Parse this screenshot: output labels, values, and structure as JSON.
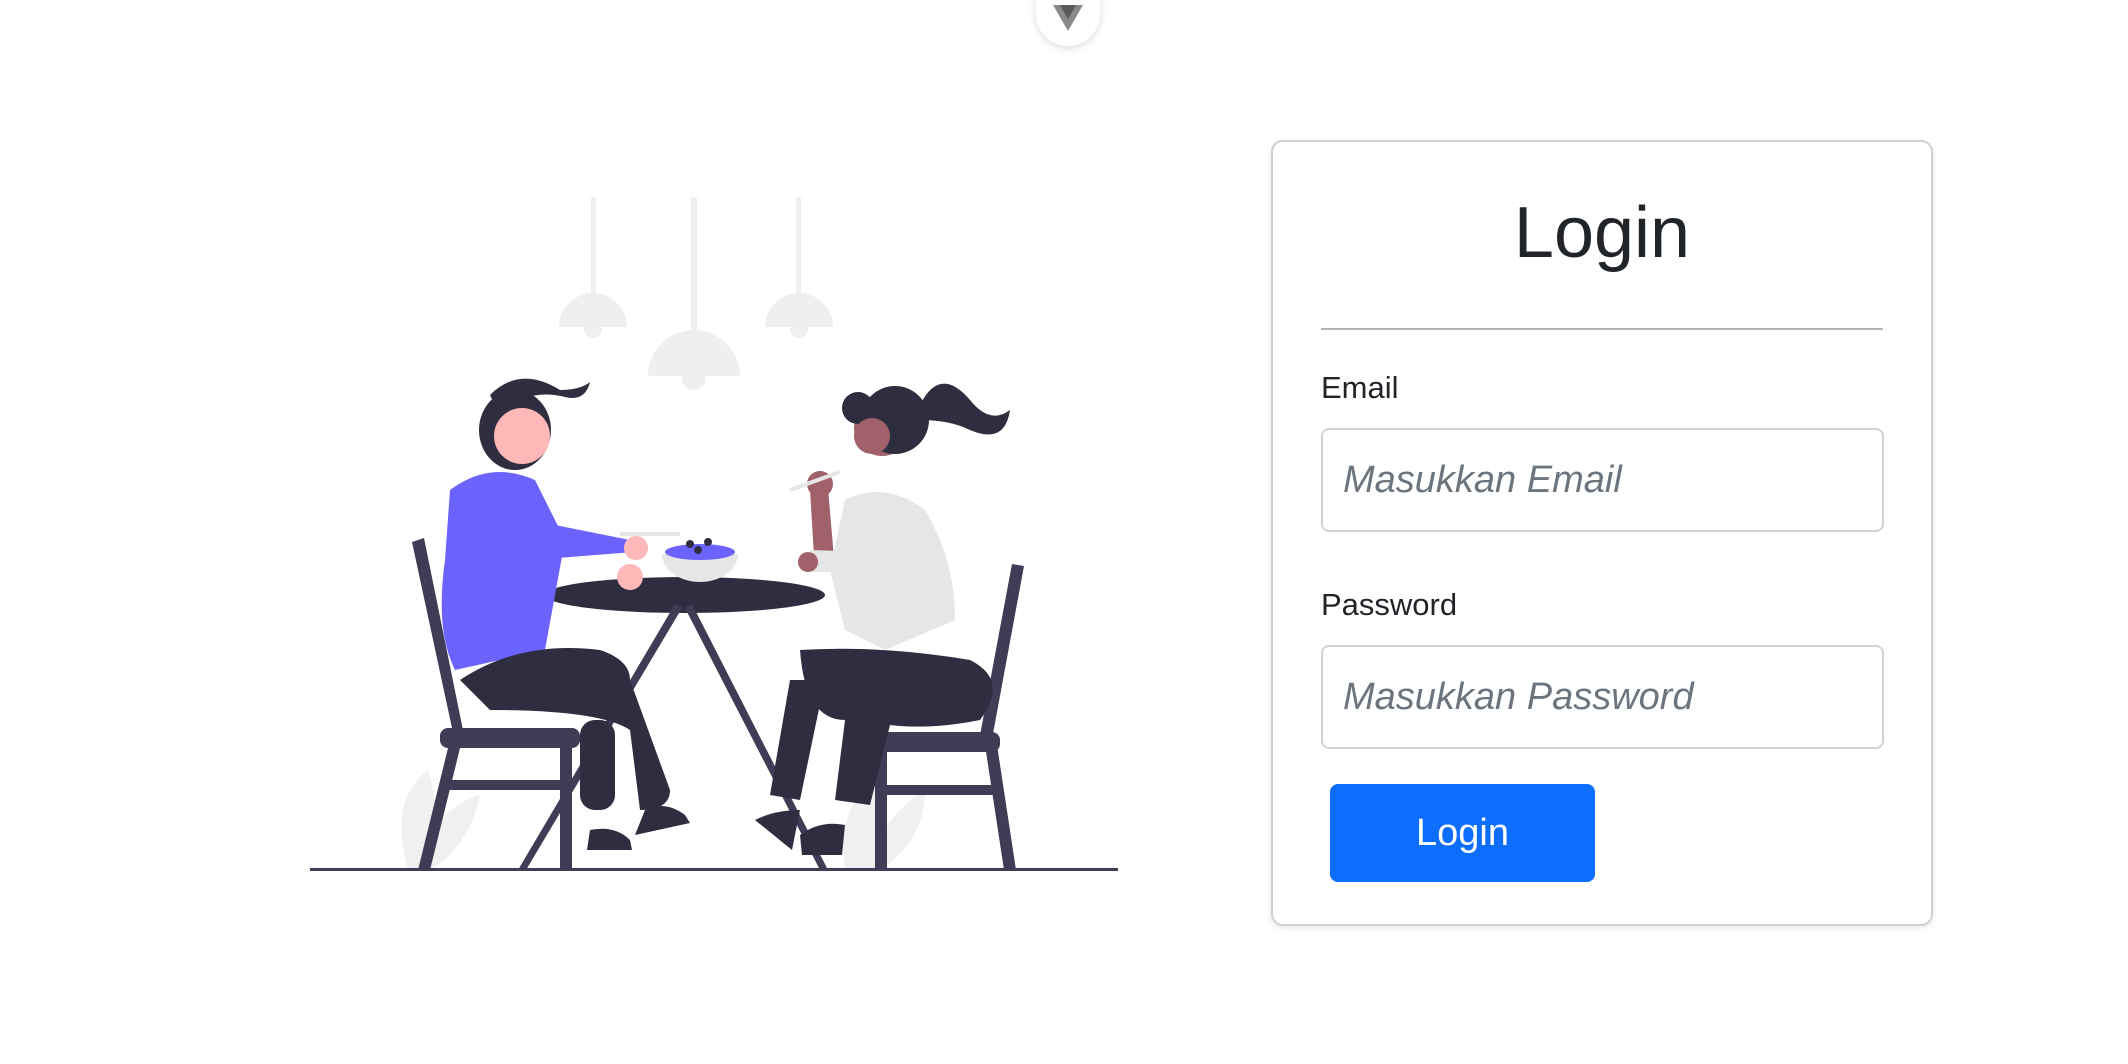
{
  "devtools": {
    "icon": "vue-logo-icon"
  },
  "illustration": {
    "icon": "dining-couple-illustration",
    "colors": {
      "dark": "#2f2e41",
      "purple": "#6c63ff",
      "light": "#e6e6e6",
      "skin_light": "#ffb8b8",
      "skin_dark": "#a0616a"
    }
  },
  "login_form": {
    "title": "Login",
    "email": {
      "label": "Email",
      "placeholder": "Masukkan Email",
      "value": ""
    },
    "password": {
      "label": "Password",
      "placeholder": "Masukkan Password",
      "value": ""
    },
    "submit_label": "Login",
    "accent_color": "#0d6efd"
  }
}
